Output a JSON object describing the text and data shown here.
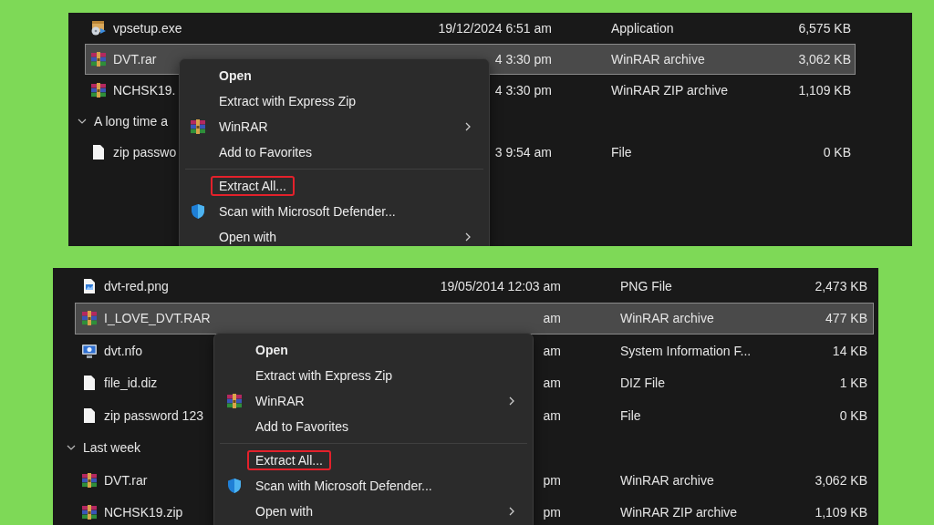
{
  "panels": [
    {
      "rows": [
        {
          "kind": "installer",
          "name": "vpsetup.exe",
          "date": "19/12/2024 6:51 am",
          "type": "Application",
          "size": "6,575 KB",
          "selected": false
        },
        {
          "kind": "archive",
          "name": "DVT.rar",
          "date": "4 3:30 pm",
          "type": "WinRAR archive",
          "size": "3,062 KB",
          "selected": true
        },
        {
          "kind": "archive",
          "name": "NCHSK19.",
          "date": "4 3:30 pm",
          "type": "WinRAR ZIP archive",
          "size": "1,109 KB",
          "selected": false
        },
        {
          "kind": "group",
          "label": "A long time a",
          "expanded": true
        },
        {
          "kind": "document",
          "name": "zip passwo",
          "date": "3 9:54 am",
          "type": "File",
          "size": "0 KB",
          "selected": false
        }
      ],
      "menu": [
        {
          "kind": "plain",
          "label": "Open",
          "default": true,
          "submenu": false,
          "highlighted": false
        },
        {
          "kind": "plain",
          "label": "Extract with Express Zip",
          "default": false,
          "submenu": false,
          "highlighted": false
        },
        {
          "kind": "archiver",
          "label": "WinRAR",
          "default": false,
          "submenu": true,
          "highlighted": false
        },
        {
          "kind": "plain",
          "label": "Add to Favorites",
          "default": false,
          "submenu": false,
          "highlighted": false
        },
        {
          "kind": "separator"
        },
        {
          "kind": "plain",
          "label": "Extract All...",
          "default": false,
          "submenu": false,
          "highlighted": true
        },
        {
          "kind": "shield",
          "label": "Scan with Microsoft Defender...",
          "default": false,
          "submenu": false,
          "highlighted": false
        },
        {
          "kind": "plain",
          "label": "Open with",
          "default": false,
          "submenu": true,
          "highlighted": false
        }
      ]
    },
    {
      "rows": [
        {
          "kind": "image",
          "name": "dvt-red.png",
          "date": "19/05/2014 12:03 am",
          "type": "PNG File",
          "size": "2,473 KB",
          "selected": false
        },
        {
          "kind": "archive",
          "name": "I_LOVE_DVT.RAR",
          "date": "am",
          "type": "WinRAR archive",
          "size": "477 KB",
          "selected": true
        },
        {
          "kind": "info",
          "name": "dvt.nfo",
          "date": "am",
          "type": "System Information F...",
          "size": "14 KB",
          "selected": false
        },
        {
          "kind": "document",
          "name": "file_id.diz",
          "date": "am",
          "type": "DIZ File",
          "size": "1 KB",
          "selected": false
        },
        {
          "kind": "document",
          "name": "zip password 123",
          "date": "am",
          "type": "File",
          "size": "0 KB",
          "selected": false
        },
        {
          "kind": "group",
          "label": "Last week",
          "expanded": true
        },
        {
          "kind": "archive",
          "name": "DVT.rar",
          "date": "pm",
          "type": "WinRAR archive",
          "size": "3,062 KB",
          "selected": false
        },
        {
          "kind": "archive",
          "name": "NCHSK19.zip",
          "date": "pm",
          "type": "WinRAR ZIP archive",
          "size": "1,109 KB",
          "selected": false
        }
      ],
      "menu": [
        {
          "kind": "plain",
          "label": "Open",
          "default": true,
          "submenu": false,
          "highlighted": false
        },
        {
          "kind": "plain",
          "label": "Extract with Express Zip",
          "default": false,
          "submenu": false,
          "highlighted": false
        },
        {
          "kind": "archiver",
          "label": "WinRAR",
          "default": false,
          "submenu": true,
          "highlighted": false
        },
        {
          "kind": "plain",
          "label": "Add to Favorites",
          "default": false,
          "submenu": false,
          "highlighted": false
        },
        {
          "kind": "separator"
        },
        {
          "kind": "plain",
          "label": "Extract All...",
          "default": false,
          "submenu": false,
          "highlighted": true
        },
        {
          "kind": "shield",
          "label": "Scan with Microsoft Defender...",
          "default": false,
          "submenu": false,
          "highlighted": false
        },
        {
          "kind": "plain",
          "label": "Open with",
          "default": false,
          "submenu": true,
          "highlighted": false
        }
      ]
    }
  ]
}
